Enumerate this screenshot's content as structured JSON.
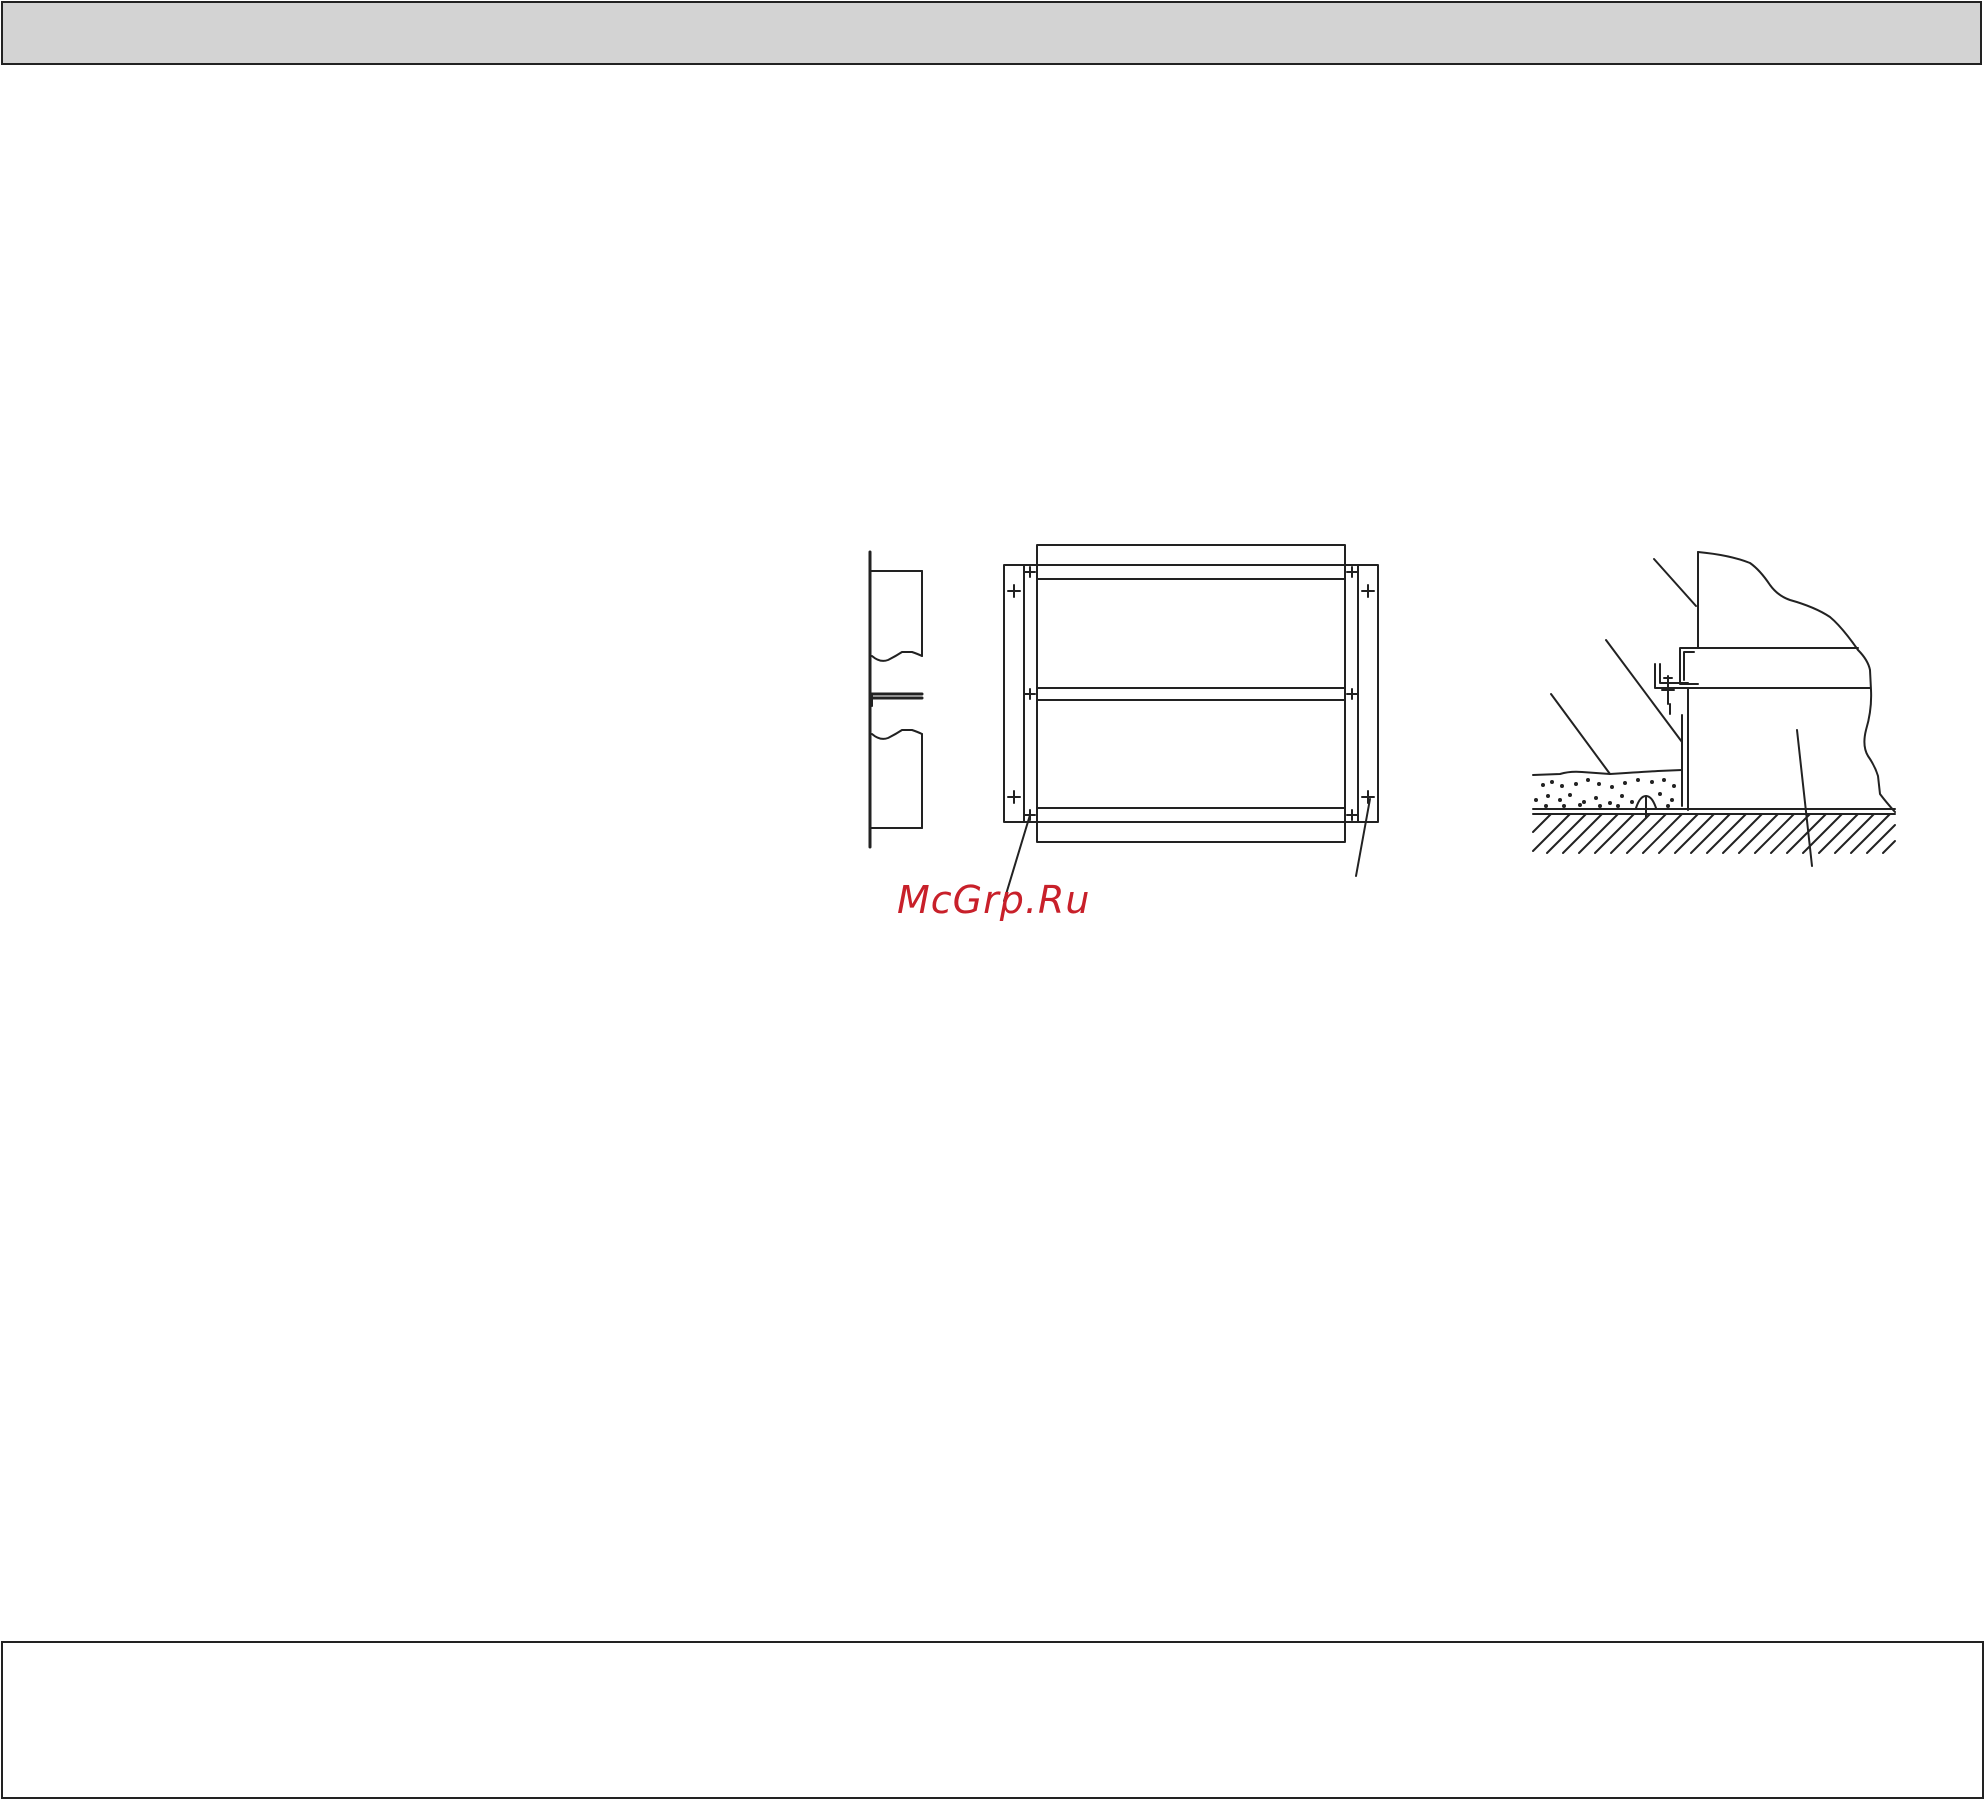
{
  "watermark": {
    "text": "McGrp.Ru",
    "color": "#c8202a"
  },
  "colors": {
    "header_bar": "#d3d3d3",
    "line": "#222222",
    "page": "#ffffff"
  }
}
